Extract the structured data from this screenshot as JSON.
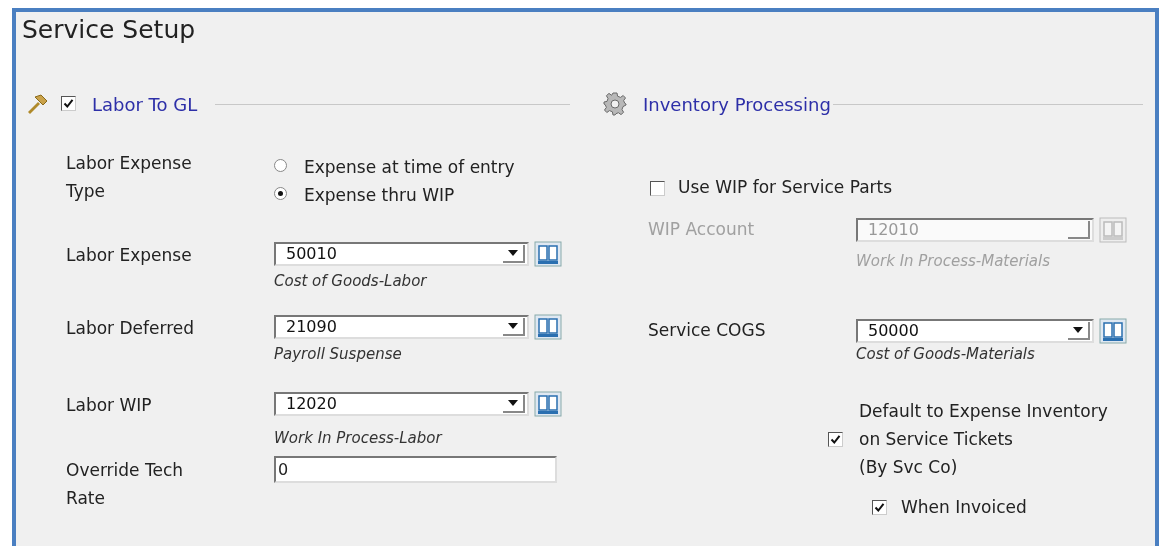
{
  "window": {
    "title": "Service Setup"
  },
  "labor_section": {
    "title": "Labor To GL",
    "checked": true,
    "expense_type": {
      "label": "Labor Expense Type",
      "options": [
        {
          "label": "Expense at time of entry",
          "selected": false
        },
        {
          "label": "Expense thru WIP",
          "selected": true
        }
      ]
    },
    "accounts": [
      {
        "label": "Labor Expense",
        "value": "50010",
        "description": "Cost of Goods-Labor"
      },
      {
        "label": "Labor Deferred",
        "value": "21090",
        "description": "Payroll Suspense"
      },
      {
        "label": "Labor WIP",
        "value": "12020",
        "description": "Work In Process-Labor"
      }
    ],
    "override_rate": {
      "label": "Override Tech Rate",
      "value": "0"
    }
  },
  "inventory_section": {
    "title": "Inventory Processing",
    "use_wip": {
      "label": "Use WIP for Service Parts",
      "checked": false
    },
    "wip_account": {
      "label": "WIP Account",
      "value": "12010",
      "description": "Work In Process-Materials",
      "disabled": true
    },
    "service_cogs": {
      "label": "Service COGS",
      "value": "50000",
      "description": "Cost of Goods-Materials",
      "disabled": false
    },
    "default_expense": {
      "lines": [
        "Default to Expense Inventory",
        "on Service Tickets",
        "(By Svc Co)"
      ],
      "checked": true
    },
    "when_invoiced": {
      "label": "When Invoiced",
      "checked": true
    }
  }
}
